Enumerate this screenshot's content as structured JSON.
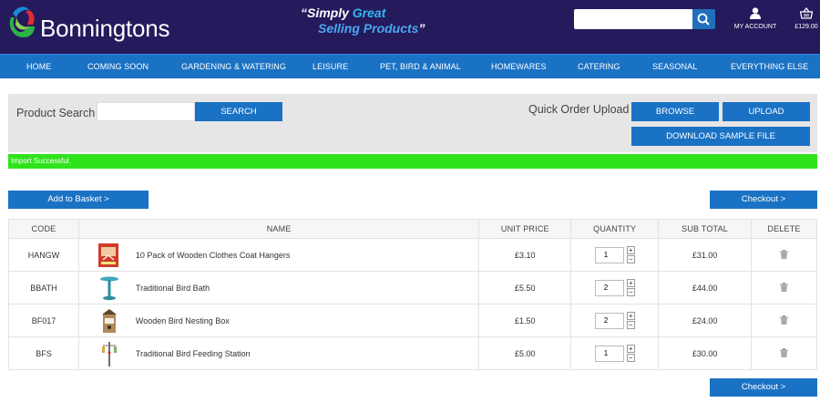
{
  "header": {
    "brand": "Bonningtons",
    "tagline_quote_open": "“",
    "tagline_simply": "Simply ",
    "tagline_great": "Great",
    "tagline_selling": "Selling Products",
    "tagline_quote_close": "”",
    "search_placeholder": "",
    "account_label": "MY ACCOUNT",
    "basket_total": "£129.00"
  },
  "nav": {
    "items": [
      "HOME",
      "COMING SOON",
      "GARDENING & WATERING",
      "LEISURE",
      "PET, BIRD & ANIMAL",
      "HOMEWARES",
      "CATERING",
      "SEASONAL",
      "EVERYTHING ELSE"
    ]
  },
  "search_panel": {
    "label": "Product Search",
    "input_value": "",
    "search_button": "SEARCH",
    "quick_order_label": "Quick Order Upload",
    "browse_button": "BROWSE",
    "upload_button": "UPLOAD",
    "download_button": "DOWNLOAD SAMPLE FILE"
  },
  "status": {
    "message": "Import Successful."
  },
  "actions": {
    "add_to_basket": "Add to Basket >",
    "checkout": "Checkout >"
  },
  "cart": {
    "columns": [
      "CODE",
      "NAME",
      "UNIT PRICE",
      "QUANTITY",
      "SUB TOTAL",
      "DELETE"
    ],
    "rows": [
      {
        "code": "HANGW",
        "name": "10 Pack of Wooden Clothes Coat Hangers",
        "unit_price": "£3.10",
        "quantity": "1",
        "sub_total": "£31.00"
      },
      {
        "code": "BBATH",
        "name": "Traditional Bird Bath",
        "unit_price": "£5.50",
        "quantity": "2",
        "sub_total": "£44.00"
      },
      {
        "code": "BF017",
        "name": "Wooden Bird Nesting Box",
        "unit_price": "£1.50",
        "quantity": "2",
        "sub_total": "£24.00"
      },
      {
        "code": "BFS",
        "name": "Traditional Bird Feeding Station",
        "unit_price": "£5.00",
        "quantity": "1",
        "sub_total": "£30.00"
      }
    ]
  },
  "colors": {
    "header_bg": "#241a5c",
    "nav_bg": "#1a72c4",
    "button_bg": "#1a72c4",
    "success_bg": "#2fe31c"
  }
}
